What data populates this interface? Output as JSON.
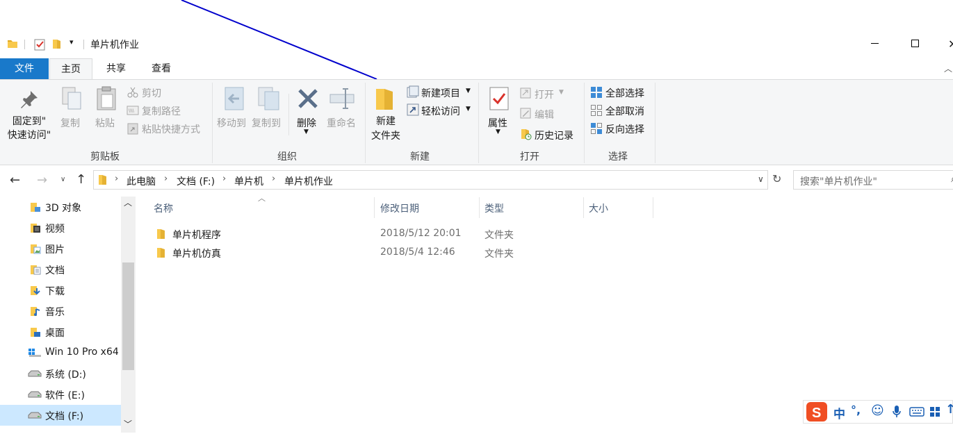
{
  "window": {
    "title": "单片机作业"
  },
  "tabs": [
    {
      "label": "文件"
    },
    {
      "label": "主页"
    },
    {
      "label": "共享"
    },
    {
      "label": "查看"
    }
  ],
  "ribbon": {
    "clipboard": {
      "pin_line1": "固定到\"",
      "pin_line2": "快速访问\"",
      "copy": "复制",
      "paste": "粘贴",
      "cut": "剪切",
      "copy_path": "复制路径",
      "paste_shortcut": "粘贴快捷方式",
      "group": "剪贴板"
    },
    "organize": {
      "move_to": "移动到",
      "copy_to": "复制到",
      "delete": "删除",
      "rename": "重命名",
      "group": "组织"
    },
    "new": {
      "new_folder_line1": "新建",
      "new_folder_line2": "文件夹",
      "new_item": "新建项目",
      "easy_access": "轻松访问",
      "group": "新建"
    },
    "open": {
      "properties": "属性",
      "open": "打开",
      "edit": "编辑",
      "history": "历史记录",
      "group": "打开"
    },
    "select": {
      "select_all": "全部选择",
      "select_none": "全部取消",
      "invert": "反向选择",
      "group": "选择"
    }
  },
  "address": {
    "crumbs": [
      "此电脑",
      "文档 (F:)",
      "单片机",
      "单片机作业"
    ],
    "search_placeholder": "搜索\"单片机作业\""
  },
  "nav": {
    "items": [
      {
        "label": "3D 对象",
        "icon": "3d-objects-icon"
      },
      {
        "label": "视频",
        "icon": "video-icon"
      },
      {
        "label": "图片",
        "icon": "pictures-icon"
      },
      {
        "label": "文档",
        "icon": "documents-icon"
      },
      {
        "label": "下载",
        "icon": "downloads-icon"
      },
      {
        "label": "音乐",
        "icon": "music-icon"
      },
      {
        "label": "桌面",
        "icon": "desktop-icon"
      },
      {
        "label": "Win 10 Pro x64",
        "icon": "windows-drive-icon"
      },
      {
        "label": "系统 (D:)",
        "icon": "drive-icon"
      },
      {
        "label": "软件 (E:)",
        "icon": "drive-icon"
      },
      {
        "label": "文档 (F:)",
        "icon": "drive-icon",
        "selected": true
      }
    ]
  },
  "list": {
    "columns": [
      "名称",
      "修改日期",
      "类型",
      "大小"
    ],
    "rows": [
      {
        "name": "单片机程序",
        "date": "2018/5/12 20:01",
        "type": "文件夹"
      },
      {
        "name": "单片机仿真",
        "date": "2018/5/4 12:46",
        "type": "文件夹"
      }
    ]
  },
  "ime": {
    "mode": "中",
    "punct": "°,"
  },
  "colors": {
    "accent": "#1979ca",
    "folder": "#f8c94c",
    "annotation_line": "#0000cc"
  }
}
